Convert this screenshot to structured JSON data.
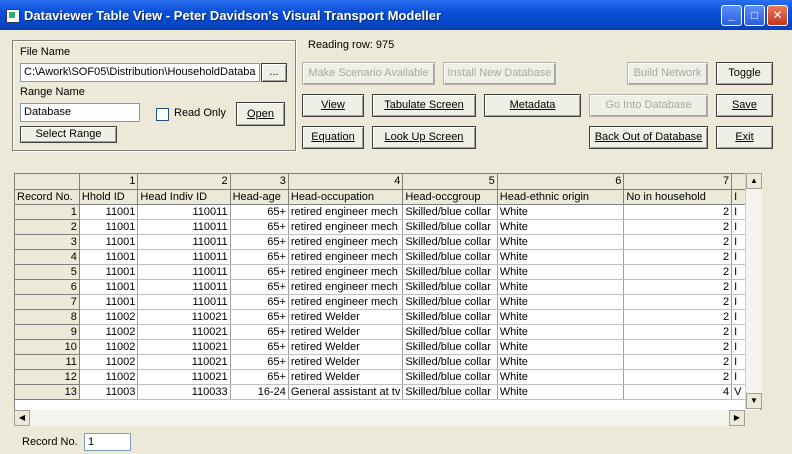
{
  "window": {
    "title": "Dataviewer Table View - Peter Davidson's Visual Transport Modeller"
  },
  "file": {
    "file_name_label": "File Name",
    "file_name_value": "C:\\Awork\\SOF05\\Distribution\\HouseholdDataba",
    "browse_label": "...",
    "range_name_label": "Range Name",
    "range_name_value": "Database",
    "read_only_label": "Read Only",
    "open_label": "Open",
    "select_range_label": "Select Range"
  },
  "status": {
    "reading_row": "Reading row:  975"
  },
  "toolbar": {
    "make_scenario": "Make Scenario Available",
    "install_db": "Install New Database",
    "build_network": "Build Network",
    "toggle": "Toggle",
    "view": "View",
    "tabulate": "Tabulate Screen",
    "metadata": "Metadata",
    "go_into_db": "Go Into Database",
    "save": "Save",
    "equation": "Equation",
    "look_up": "Look Up Screen",
    "back_out": "Back Out of Database",
    "exit": "Exit"
  },
  "grid": {
    "col_numbers": [
      "",
      "1",
      "2",
      "3",
      "4",
      "5",
      "6",
      "7",
      ""
    ],
    "headers": [
      "Record No.",
      "Hhold ID",
      "Head Indiv ID",
      "Head-age",
      "Head-occupation",
      "Head-occgroup",
      "Head-ethnic origin",
      "No in household",
      "I"
    ],
    "rows": [
      [
        "1",
        "11001",
        "110011",
        "65+",
        "retired engineer mech",
        "Skilled/blue collar",
        "White",
        "2",
        "I"
      ],
      [
        "2",
        "11001",
        "110011",
        "65+",
        "retired engineer mech",
        "Skilled/blue collar",
        "White",
        "2",
        "I"
      ],
      [
        "3",
        "11001",
        "110011",
        "65+",
        "retired engineer mech",
        "Skilled/blue collar",
        "White",
        "2",
        "I"
      ],
      [
        "4",
        "11001",
        "110011",
        "65+",
        "retired engineer mech",
        "Skilled/blue collar",
        "White",
        "2",
        "I"
      ],
      [
        "5",
        "11001",
        "110011",
        "65+",
        "retired engineer mech",
        "Skilled/blue collar",
        "White",
        "2",
        "I"
      ],
      [
        "6",
        "11001",
        "110011",
        "65+",
        "retired engineer mech",
        "Skilled/blue collar",
        "White",
        "2",
        "I"
      ],
      [
        "7",
        "11001",
        "110011",
        "65+",
        "retired engineer mech",
        "Skilled/blue collar",
        "White",
        "2",
        "I"
      ],
      [
        "8",
        "11002",
        "110021",
        "65+",
        "retired Welder",
        "Skilled/blue collar",
        "White",
        "2",
        "I"
      ],
      [
        "9",
        "11002",
        "110021",
        "65+",
        "retired Welder",
        "Skilled/blue collar",
        "White",
        "2",
        "I"
      ],
      [
        "10",
        "11002",
        "110021",
        "65+",
        "retired Welder",
        "Skilled/blue collar",
        "White",
        "2",
        "I"
      ],
      [
        "11",
        "11002",
        "110021",
        "65+",
        "retired Welder",
        "Skilled/blue collar",
        "White",
        "2",
        "I"
      ],
      [
        "12",
        "11002",
        "110021",
        "65+",
        "retired Welder",
        "Skilled/blue collar",
        "White",
        "2",
        "I"
      ],
      [
        "13",
        "11003",
        "110033",
        "16-24",
        "General assistant at tv",
        "Skilled/blue collar",
        "White",
        "4",
        "V"
      ]
    ]
  },
  "footer": {
    "record_no_label": "Record No.",
    "record_no_value": "1"
  }
}
